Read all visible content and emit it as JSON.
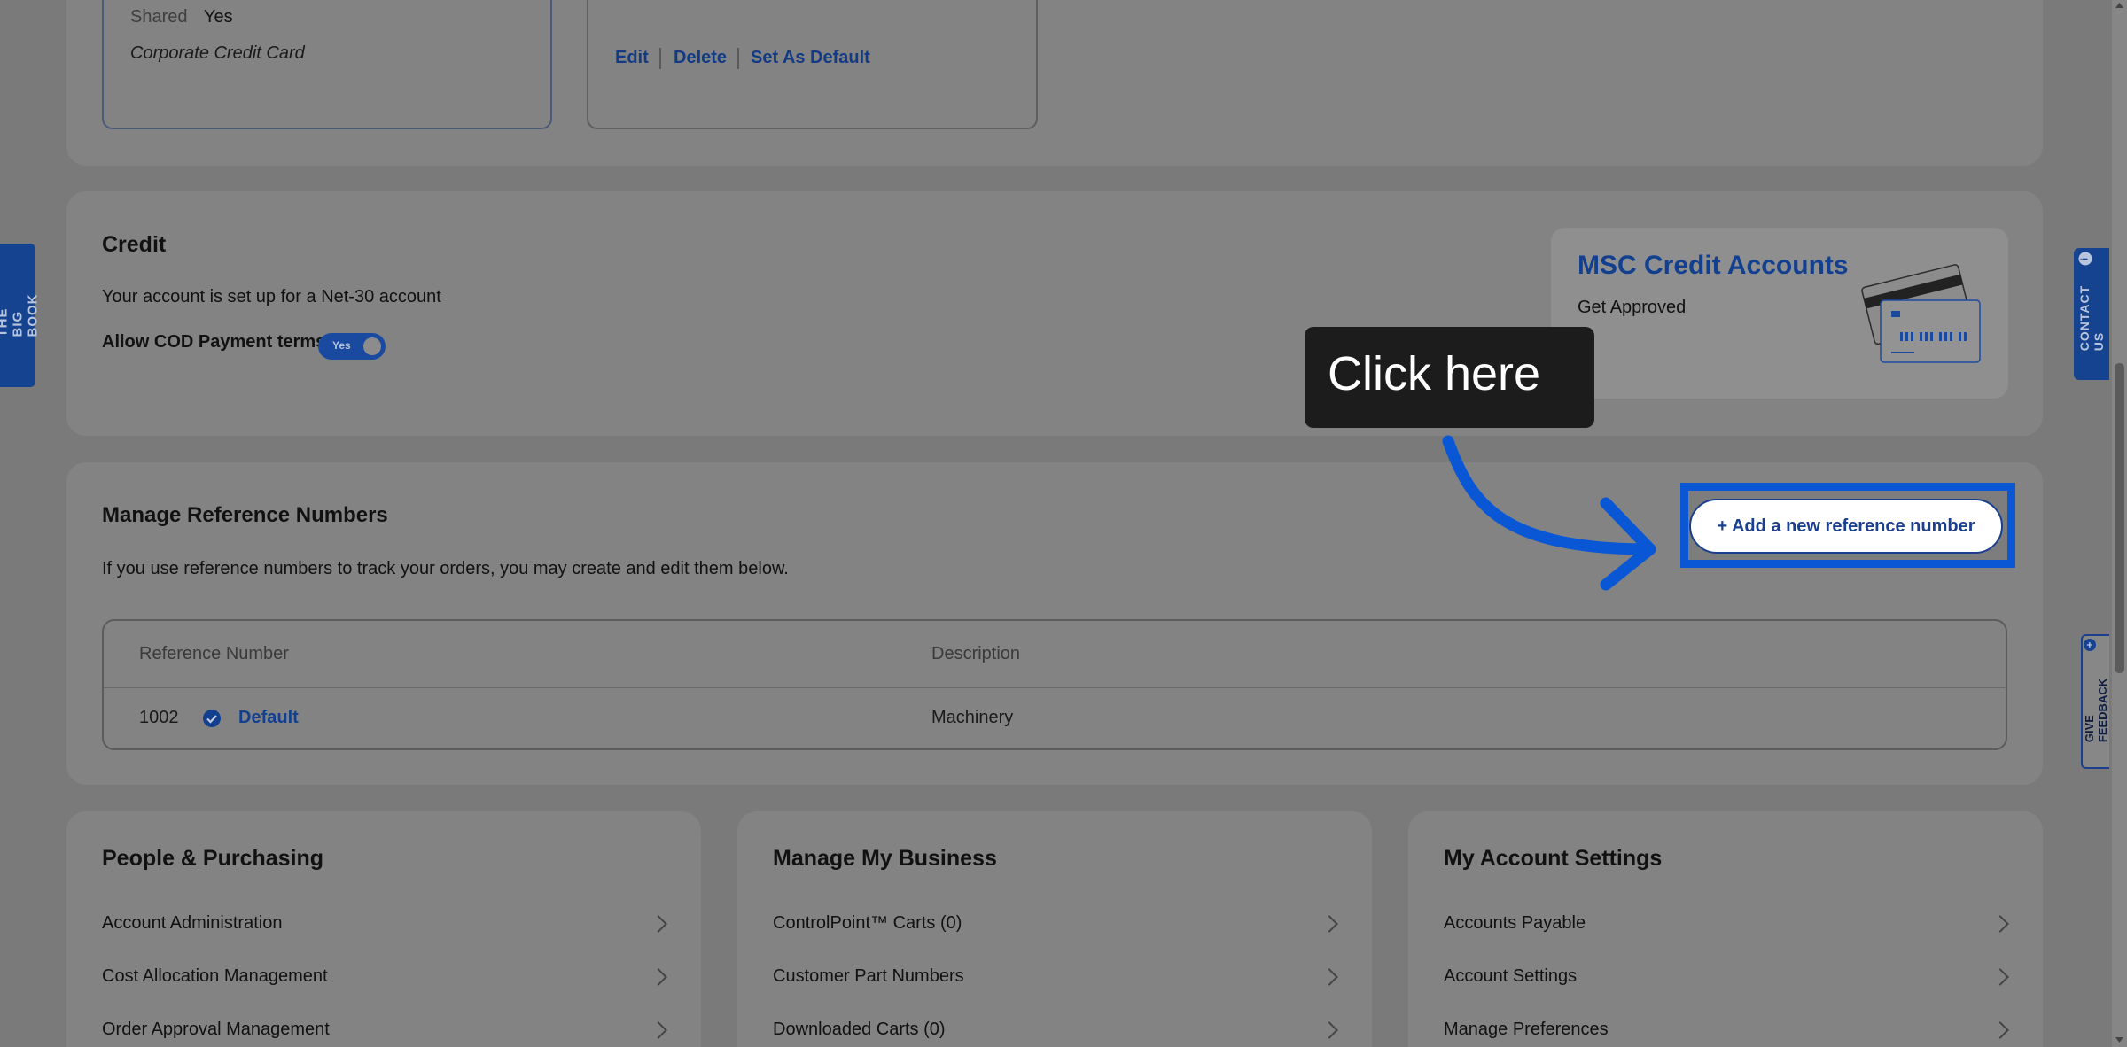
{
  "payment_card": {
    "shared_label": "Shared",
    "shared_value": "Yes",
    "card_type": "Corporate Credit Card"
  },
  "card_actions": {
    "edit": "Edit",
    "delete": "Delete",
    "set_default": "Set As Default"
  },
  "credit": {
    "title": "Credit",
    "description": "Your account is set up for a Net-30 account",
    "cod_label": "Allow COD Payment terms",
    "cod_toggle": "Yes"
  },
  "promo": {
    "title": "MSC Credit Accounts",
    "subtitle": "Get Approved"
  },
  "tooltip": {
    "text": "Click here"
  },
  "reference": {
    "title": "Manage Reference Numbers",
    "description": "If you use reference numbers to track your orders, you may create and edit them below.",
    "add_button": "+ Add a new reference number",
    "columns": [
      "Reference Number",
      "Description"
    ],
    "rows": [
      {
        "number": "1002",
        "badge": "Default",
        "description": "Machinery"
      }
    ]
  },
  "sections": [
    {
      "title": "People & Purchasing",
      "items": [
        "Account Administration",
        "Cost Allocation Management",
        "Order Approval Management"
      ]
    },
    {
      "title": "Manage My Business",
      "items": [
        "ControlPoint™ Carts (0)",
        "Customer Part Numbers",
        "Downloaded Carts (0)"
      ]
    },
    {
      "title": "My Account Settings",
      "items": [
        "Accounts Payable",
        "Account Settings",
        "Manage Preferences"
      ]
    }
  ],
  "side_tabs": {
    "left": "THE BIG BOOK",
    "contact": "CONTACT US",
    "feedback": "GIVE FEEDBACK"
  },
  "colors": {
    "accent": "#0a57d6",
    "brand_blue": "#16438f",
    "overlay": "#7a7a7a"
  }
}
